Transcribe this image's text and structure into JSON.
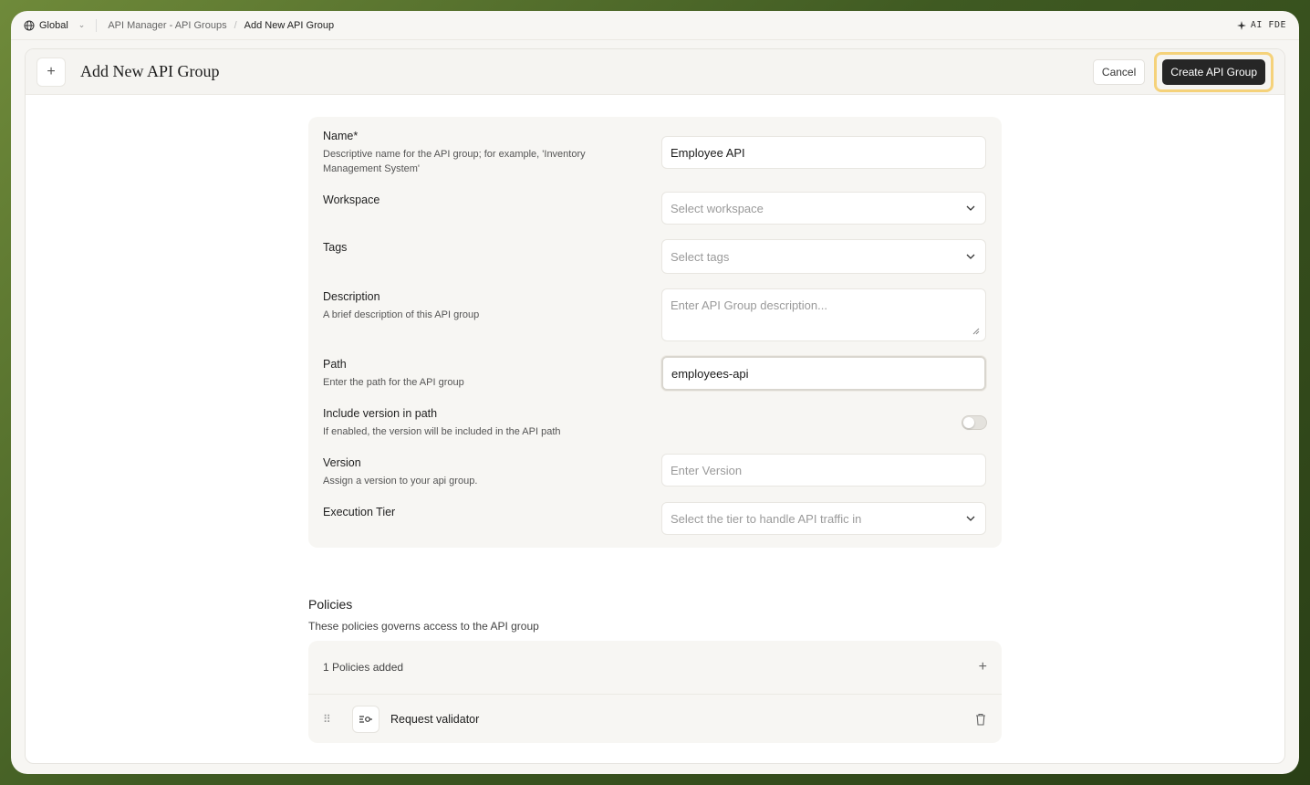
{
  "topbar": {
    "scope": "Global",
    "breadcrumbs": [
      "API Manager - API Groups",
      "Add New API Group"
    ],
    "ai_label": "AI FDE"
  },
  "header": {
    "title": "Add New API Group",
    "cancel_label": "Cancel",
    "create_label": "Create API Group"
  },
  "form": {
    "name": {
      "label": "Name*",
      "hint": "Descriptive name for the API group; for example, 'Inventory Management System'",
      "value": "Employee API"
    },
    "workspace": {
      "label": "Workspace",
      "placeholder": "Select workspace"
    },
    "tags": {
      "label": "Tags",
      "placeholder": "Select tags"
    },
    "description": {
      "label": "Description",
      "hint": "A brief description of this API group",
      "placeholder": "Enter API Group description..."
    },
    "path": {
      "label": "Path",
      "hint": "Enter the path for the API group",
      "value": "employees-api"
    },
    "include_version": {
      "label": "Include version in path",
      "hint": "If enabled, the version will be included in the API path",
      "enabled": false
    },
    "version": {
      "label": "Version",
      "hint": "Assign a version to your api group.",
      "placeholder": "Enter Version"
    },
    "execution_tier": {
      "label": "Execution Tier",
      "placeholder": "Select the tier to handle API traffic in"
    }
  },
  "policies": {
    "title": "Policies",
    "subtitle": "These policies governs access to the API group",
    "count_label": "1 Policies added",
    "items": [
      {
        "name": "Request validator",
        "icon": "request-validator-icon"
      }
    ]
  },
  "colors": {
    "accent_dark": "#262626",
    "highlight": "#f5d27a",
    "surface": "#f7f6f3"
  }
}
